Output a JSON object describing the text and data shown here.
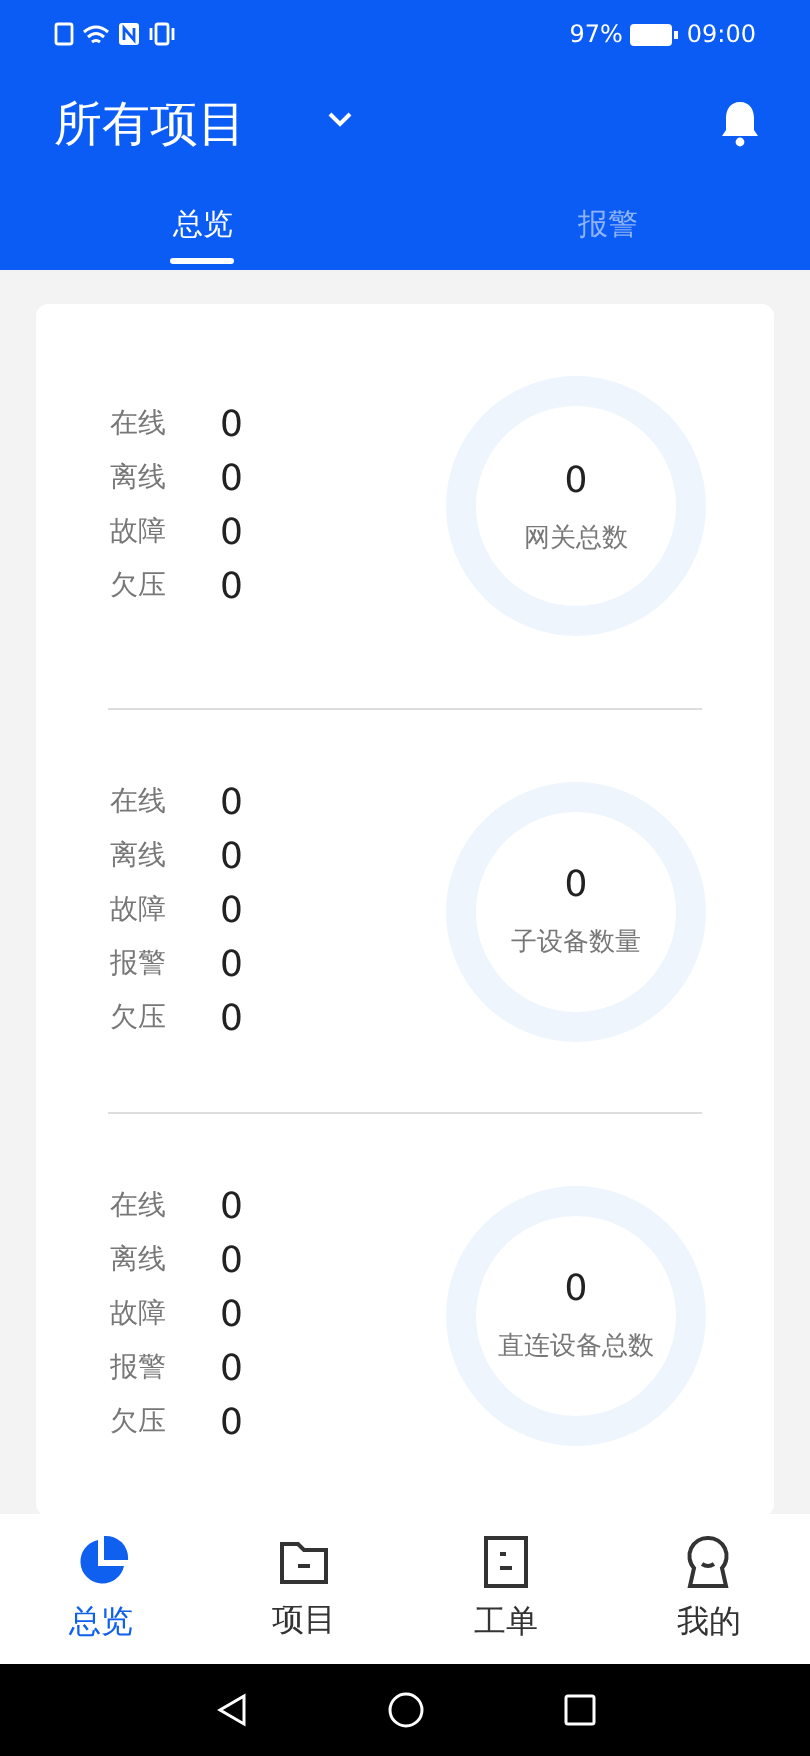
{
  "status_bar": {
    "battery": "97%",
    "time": "09:00"
  },
  "header": {
    "title": "所有项目"
  },
  "tabs": [
    {
      "label": "总览",
      "selected": true
    },
    {
      "label": "报警",
      "selected": false
    }
  ],
  "sections": [
    {
      "stats": [
        {
          "label": "在线",
          "value": "0"
        },
        {
          "label": "离线",
          "value": "0"
        },
        {
          "label": "故障",
          "value": "0"
        },
        {
          "label": "欠压",
          "value": "0"
        }
      ],
      "total": {
        "value": "0",
        "label": "网关总数"
      }
    },
    {
      "stats": [
        {
          "label": "在线",
          "value": "0"
        },
        {
          "label": "离线",
          "value": "0"
        },
        {
          "label": "故障",
          "value": "0"
        },
        {
          "label": "报警",
          "value": "0"
        },
        {
          "label": "欠压",
          "value": "0"
        }
      ],
      "total": {
        "value": "0",
        "label": "子设备数量"
      }
    },
    {
      "stats": [
        {
          "label": "在线",
          "value": "0"
        },
        {
          "label": "离线",
          "value": "0"
        },
        {
          "label": "故障",
          "value": "0"
        },
        {
          "label": "报警",
          "value": "0"
        },
        {
          "label": "欠压",
          "value": "0"
        }
      ],
      "total": {
        "value": "0",
        "label": "直连设备总数"
      }
    }
  ],
  "bottom_nav": [
    {
      "label": "总览",
      "kind": "chart",
      "selected": true
    },
    {
      "label": "项目",
      "kind": "folder",
      "selected": false
    },
    {
      "label": "工单",
      "kind": "document",
      "selected": false
    },
    {
      "label": "我的",
      "kind": "person",
      "selected": false
    }
  ]
}
